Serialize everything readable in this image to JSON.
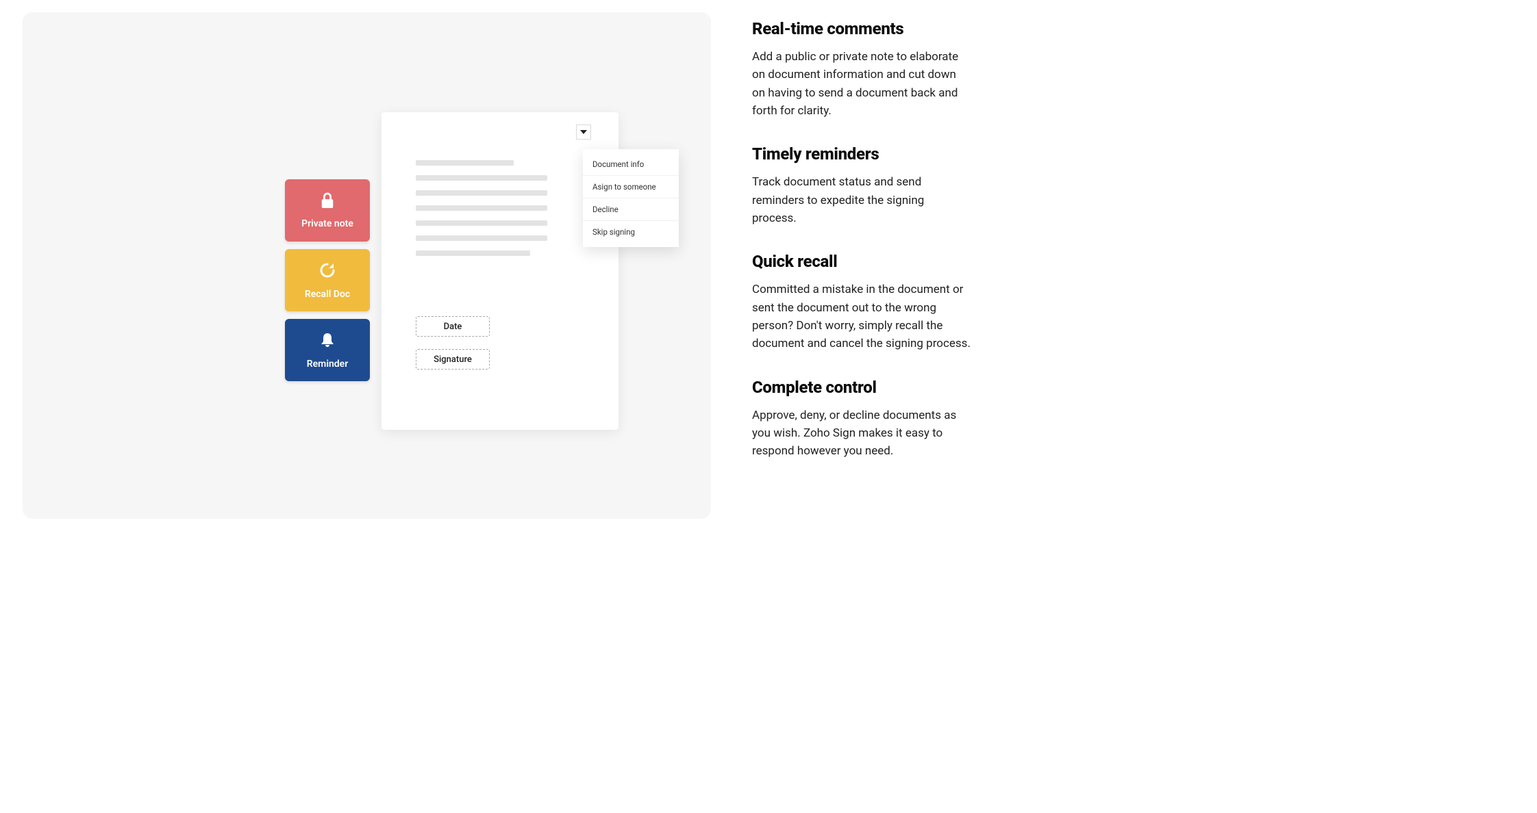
{
  "tiles": {
    "private_note_label": "Private note",
    "recall_doc_label": "Recall Doc",
    "reminder_label": "Reminder"
  },
  "doc": {
    "field_date_label": "Date",
    "field_signature_label": "Signature"
  },
  "dropdown": {
    "items": {
      "info": "Document info",
      "assign": "Asign to someone",
      "decline": "Decline",
      "skip": "Skip signing"
    }
  },
  "features": {
    "comments": {
      "title": "Real-time comments",
      "body": "Add a public or private note to elaborate on document information and cut down on having to send a document back and forth for clarity."
    },
    "reminders": {
      "title": "Timely reminders",
      "body": "Track document status and send reminders to expedite the signing process."
    },
    "recall": {
      "title": "Quick recall",
      "body": "Committed a mistake in the document or sent the document out to the wrong person? Don't worry, simply recall the document and cancel the signing process."
    },
    "control": {
      "title": "Complete control",
      "body": "Approve, deny, or decline documents as you wish. Zoho Sign makes it easy to respond however you need."
    }
  },
  "colors": {
    "tile_private": "#e06a6e",
    "tile_recall": "#f1bb3e",
    "tile_reminder": "#1e4b8f",
    "panel_bg": "#f6f6f6"
  }
}
